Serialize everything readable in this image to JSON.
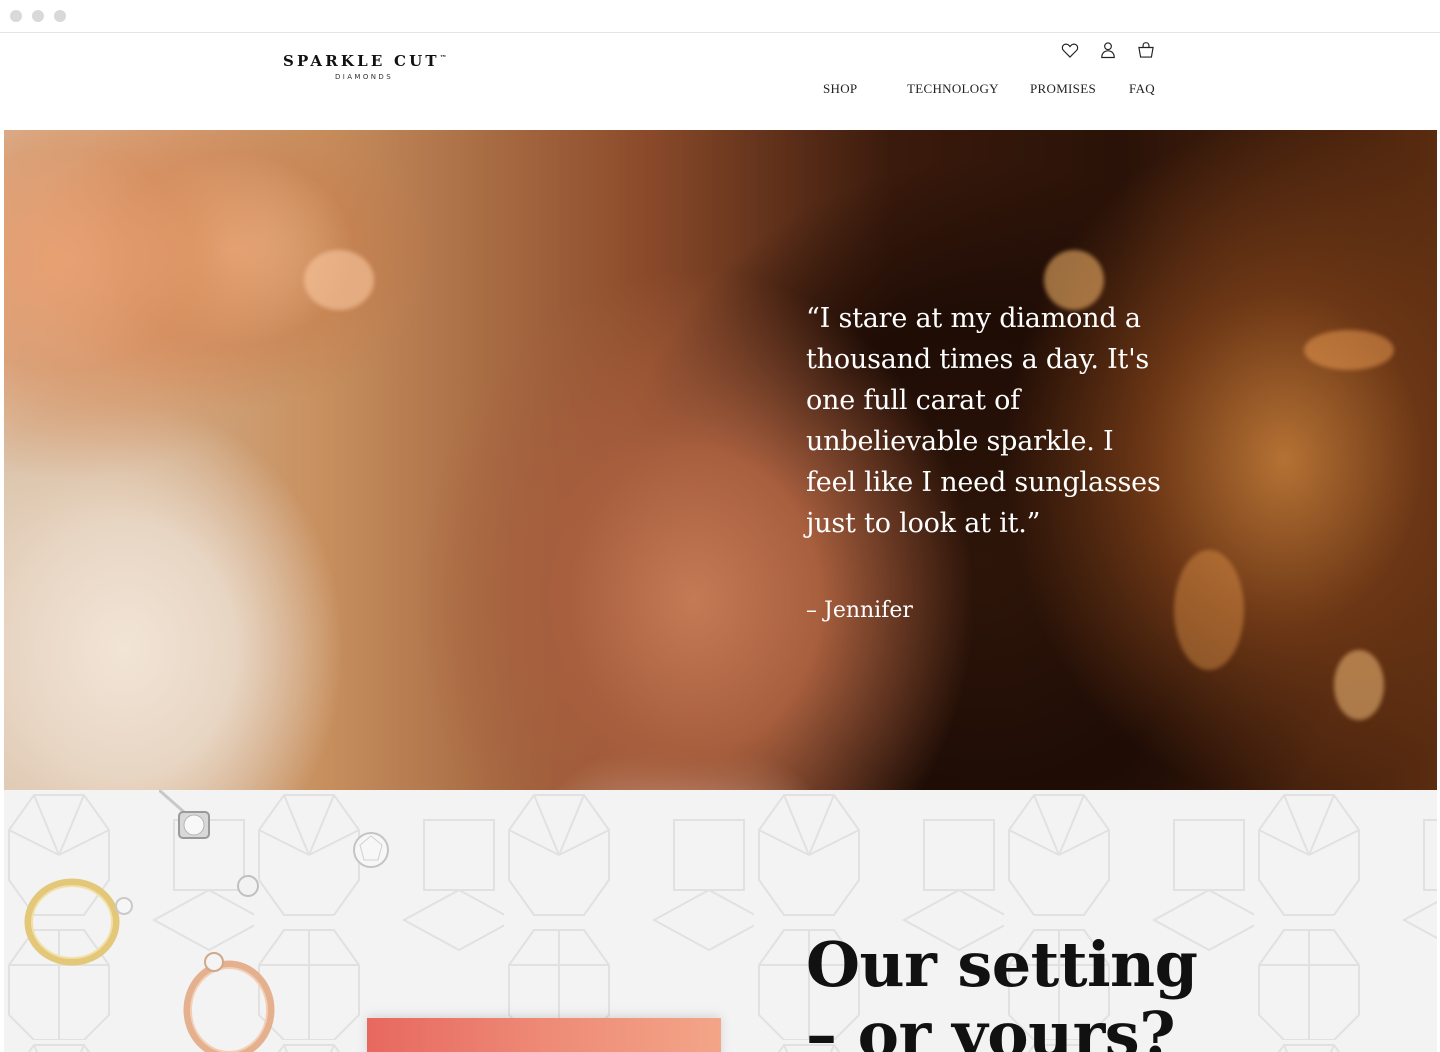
{
  "brand": {
    "name": "SPARKLE CUT",
    "trademark": "™",
    "sub": "DIAMONDS"
  },
  "header": {
    "icons": [
      "heart-icon",
      "account-icon",
      "bag-icon"
    ],
    "nav": [
      "SHOP",
      "TECHNOLOGY",
      "PROMISES",
      "FAQ"
    ]
  },
  "hero": {
    "quote": "“I stare at my diamond a thousand times a day. It's one full carat of unbelievable sparkle. I feel like I need sunglasses just to look at it.”",
    "author": "– Jennifer"
  },
  "settings_section": {
    "heading_line1": "Our setting",
    "heading_line2": "– or yours?"
  },
  "colors": {
    "background": "#ffffff",
    "text": "#111111",
    "accent_coral": "#e7685f",
    "pattern_bg": "#f3f3f3"
  }
}
